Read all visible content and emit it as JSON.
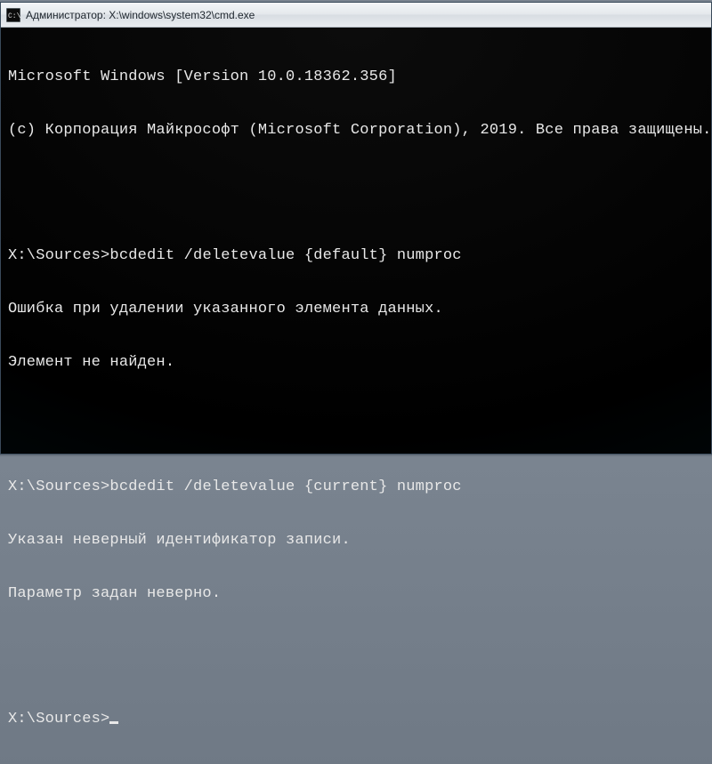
{
  "window": {
    "title": "Администратор: X:\\windows\\system32\\cmd.exe"
  },
  "terminal": {
    "banner_line1": "Microsoft Windows [Version 10.0.18362.356]",
    "banner_line2": "(c) Корпорация Майкрософт (Microsoft Corporation), 2019. Все права защищены.",
    "blank1": "",
    "block1": {
      "prompt": "X:\\Sources>",
      "command": "bcdedit /deletevalue {default} numproc",
      "out1": "Ошибка при удалении указанного элемента данных.",
      "out2": "Элемент не найден."
    },
    "blank2": "",
    "block2": {
      "prompt": "X:\\Sources>",
      "command": "bcdedit /deletevalue {current} numproc",
      "out1": "Указан неверный идентификатор записи.",
      "out2": "Параметр задан неверно."
    },
    "blank3": "",
    "current": {
      "prompt": "X:\\Sources>"
    }
  }
}
